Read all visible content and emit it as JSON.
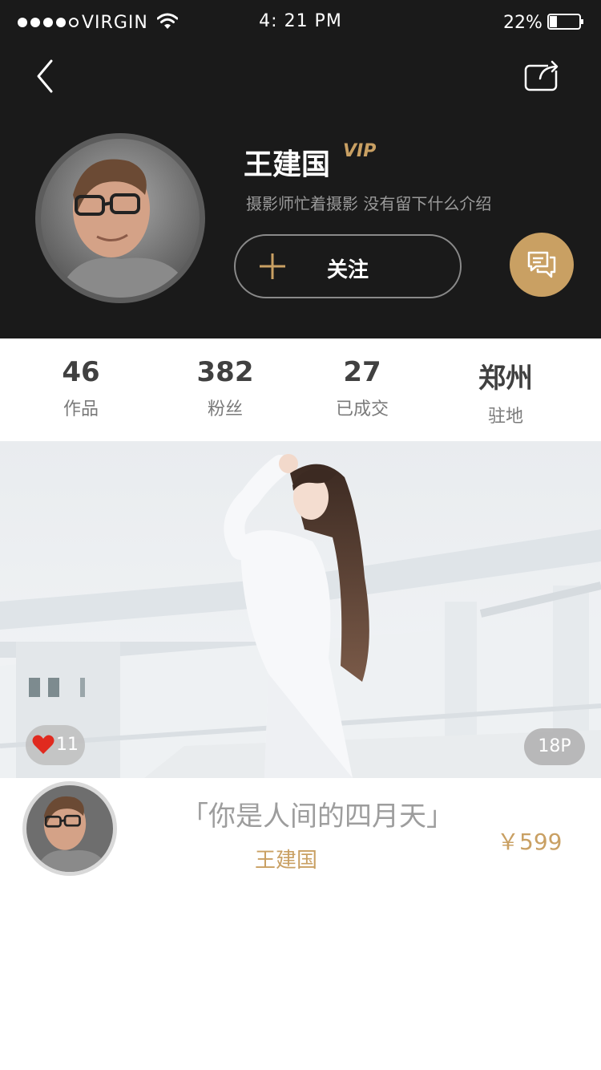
{
  "status_bar": {
    "carrier": "VIRGIN",
    "time": "4: 21 PM",
    "battery_percent": "22%",
    "battery_level": 0.22,
    "signal_bars_filled": 4,
    "signal_bars_total": 5
  },
  "nav": {
    "back_icon": "chevron-left-icon",
    "share_icon": "share-icon"
  },
  "profile": {
    "name": "王建国",
    "badge": "VIP",
    "bio": "摄影师忙着摄影 没有留下什么介绍",
    "follow_label": "关注",
    "follow_icon": "plus-icon",
    "message_icon": "chat-icon"
  },
  "stats": [
    {
      "value": "46",
      "label": "作品"
    },
    {
      "value": "382",
      "label": "粉丝"
    },
    {
      "value": "27",
      "label": "已成交"
    },
    {
      "value": "郑州",
      "label": "驻地"
    }
  ],
  "work": {
    "likes": "11",
    "pages": "18P",
    "title": "「你是人间的四月天」",
    "author": "王建国",
    "price": "￥599"
  },
  "colors": {
    "header_bg": "#1a1a1a",
    "accent_gold": "#c9a063",
    "like_red": "#e02a1f"
  }
}
